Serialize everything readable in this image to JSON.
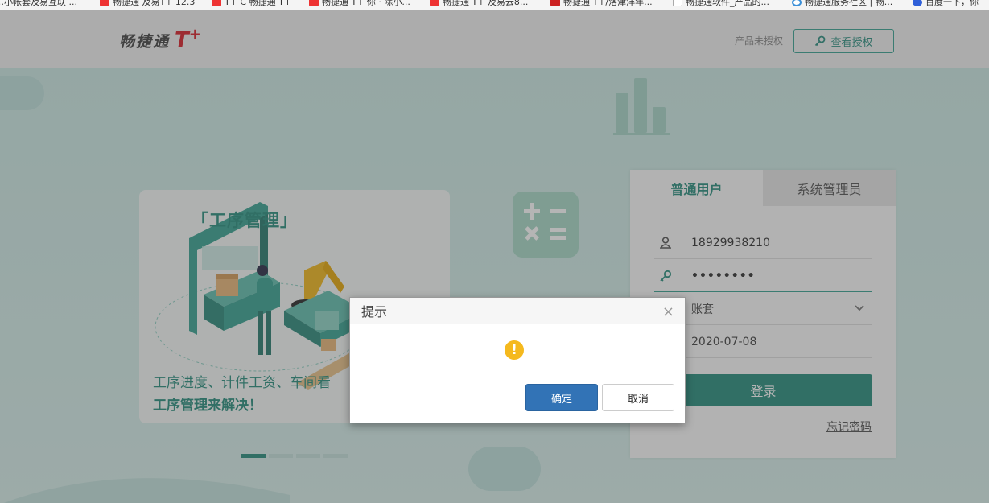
{
  "bookmarks": [
    {
      "label": "…小帐套及易互联 ...",
      "icon": "bookmark-favicon",
      "color": "#d23"
    },
    {
      "label": "畅捷通 及易T+ 12.3",
      "icon": "bookmark-favicon",
      "color": "#e33"
    },
    {
      "label": "T+ C 畅捷通 T+",
      "icon": "bookmark-favicon",
      "color": "#e33"
    },
    {
      "label": "畅捷通 T+ 你 · 除小...",
      "icon": "bookmark-favicon",
      "color": "#e33"
    },
    {
      "label": "畅捷通 T+ 及易云8...",
      "icon": "bookmark-favicon",
      "color": "#e33"
    },
    {
      "label": "畅捷通 T+/洛津洋年...",
      "icon": "bookmark-favicon",
      "color": "#c22"
    },
    {
      "label": "畅捷通软件_产品的...",
      "icon": "page-icon",
      "color": "#ccc"
    },
    {
      "label": "畅捷通服务社区 | 畅...",
      "icon": "refresh-icon",
      "color": "#3a8fd8"
    },
    {
      "label": "百度一下，你",
      "icon": "baidu-icon",
      "color": "#2f5fd8"
    }
  ],
  "header": {
    "logo_cn": "畅捷通",
    "logo_t": "T",
    "logo_plus": "+",
    "unauthorized": "产品未授权",
    "view_auth": "查看授权"
  },
  "card": {
    "title": "「工序管理」",
    "desc_line1": "工序进度、计件工资、车间看",
    "desc_line2": "工序管理来解决！"
  },
  "carousel": {
    "count": 4,
    "active": 0
  },
  "login": {
    "tabs": [
      {
        "label": "普通用户",
        "active": true
      },
      {
        "label": "系统管理员",
        "active": false
      }
    ],
    "username": "18929938210",
    "password": "••••••••",
    "account_placeholder": "账套",
    "date": "2020-07-08",
    "submit": "登录",
    "forgot": "忘记密码"
  },
  "dialog": {
    "title": "提示",
    "close": "×",
    "icon": "!",
    "ok": "确定",
    "cancel": "取消"
  },
  "colors": {
    "brand_green": "#2a8f7f",
    "brand_red": "#d9232d",
    "ok_blue": "#3273b6",
    "warning_yellow": "#f5b91e"
  }
}
